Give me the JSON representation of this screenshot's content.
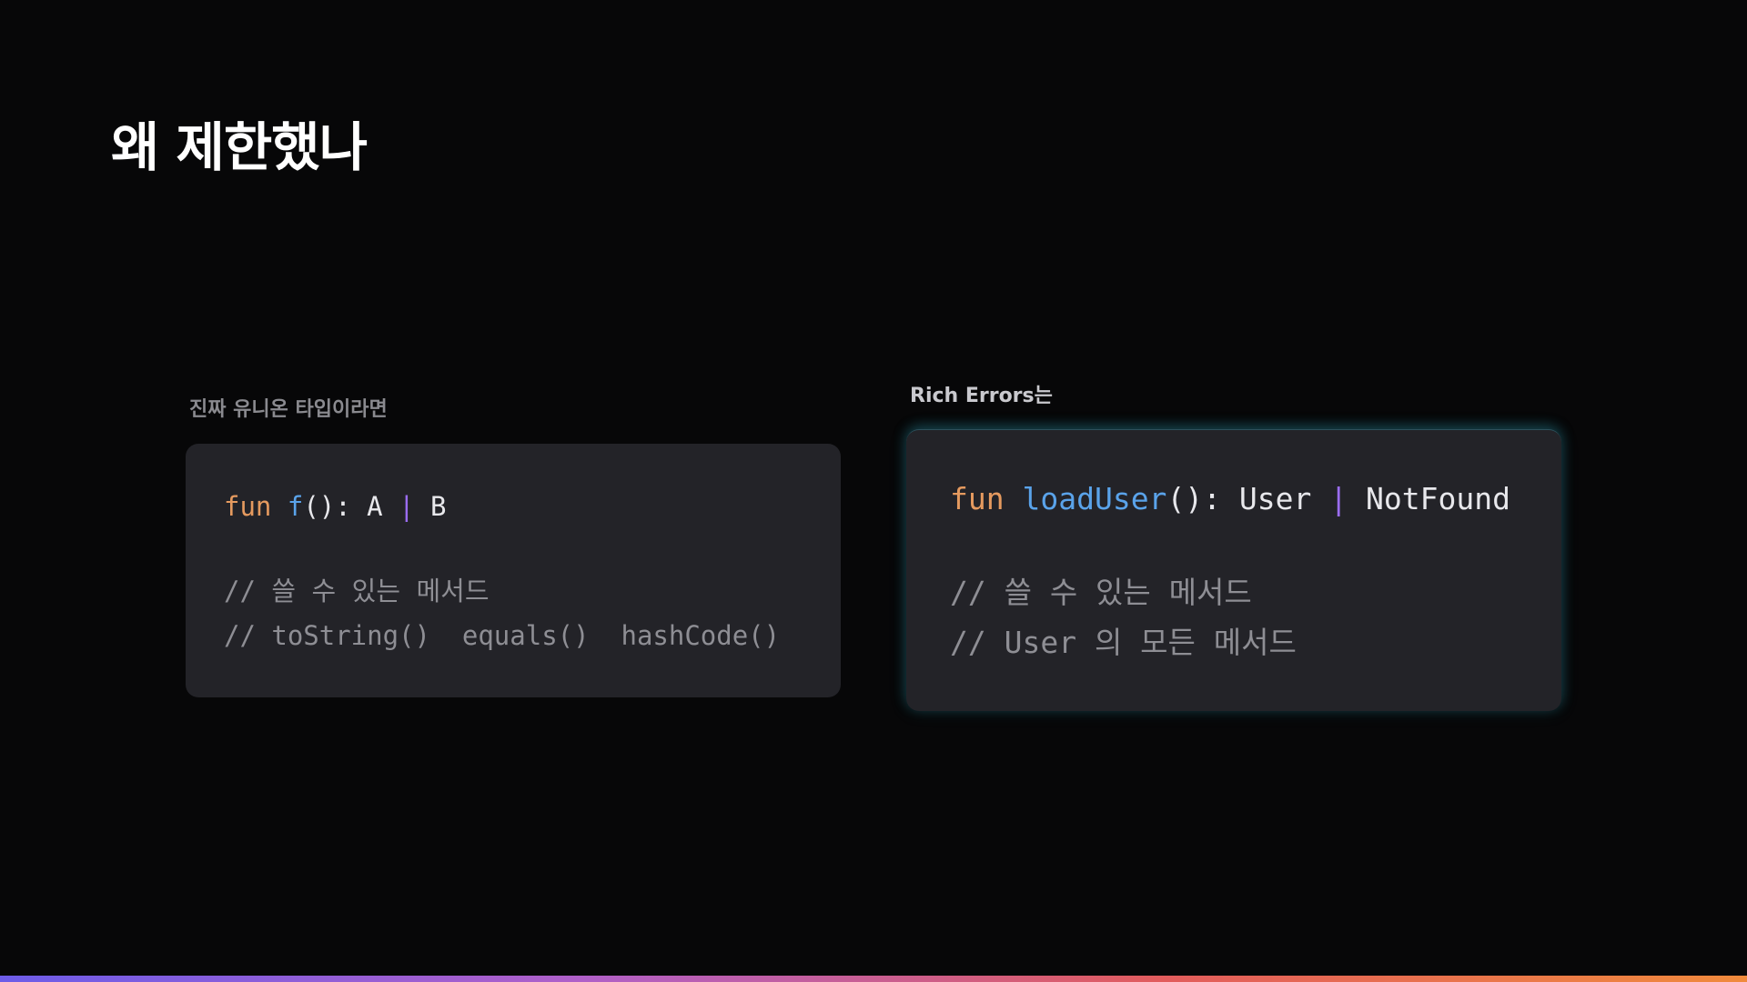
{
  "title": "왜 제한했나",
  "left_panel": {
    "label": "진짜 유니온 타입이라면",
    "signature": {
      "keyword": "fun",
      "function_name": "f",
      "params_and_colon": "(): A",
      "pipe": "|",
      "second_type": "B"
    },
    "comment_lines": [
      "// 쓸 수 있는 메서드",
      "// toString()  equals()  hashCode()"
    ]
  },
  "right_panel": {
    "label": "Rich Errors는",
    "signature": {
      "keyword": "fun",
      "function_name": "loadUser",
      "params_and_colon": "(): User",
      "pipe": "|",
      "second_type": "NotFound"
    },
    "comment_lines": [
      "// 쓸 수 있는 메서드",
      "// User 의 모든 메서드"
    ]
  },
  "colors": {
    "background": "#070708",
    "card": "#232328",
    "keyword": "#e59a5f",
    "function_name": "#5aa3ea",
    "pipe": "#9a6cf0",
    "comment": "#8e8e94",
    "glow": "#2896aa",
    "bottom_gradient": [
      "#6d5ce8",
      "#b05fc8",
      "#e25c5c",
      "#f08a3c"
    ]
  }
}
